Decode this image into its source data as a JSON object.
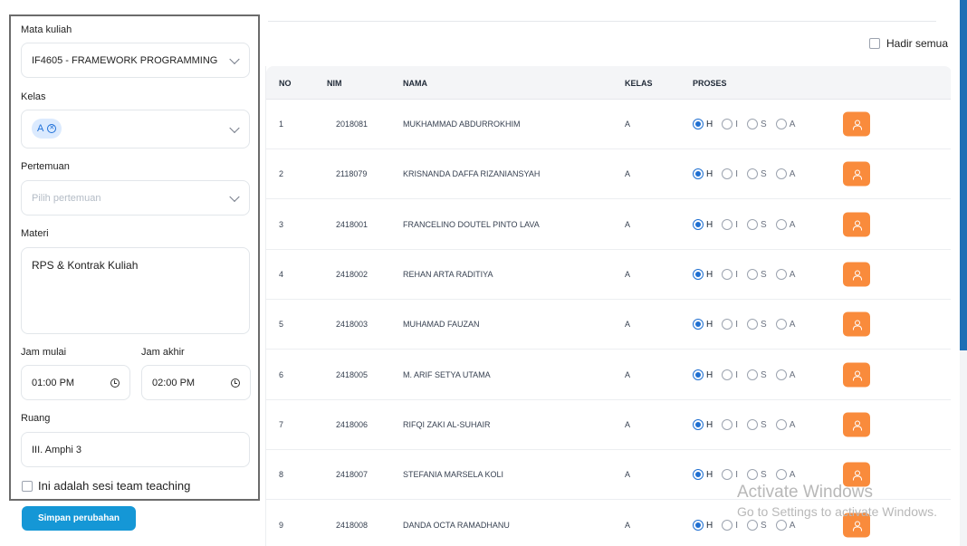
{
  "form": {
    "mata_kuliah_label": "Mata kuliah",
    "mata_kuliah_value": "IF4605 - FRAMEWORK PROGRAMMING",
    "kelas_label": "Kelas",
    "kelas_tag": "A",
    "pertemuan_label": "Pertemuan",
    "pertemuan_placeholder": "Pilih pertemuan",
    "materi_label": "Materi",
    "materi_value": "RPS & Kontrak Kuliah",
    "jam_mulai_label": "Jam mulai",
    "jam_mulai_value": "01:00 PM",
    "jam_akhir_label": "Jam akhir",
    "jam_akhir_value": "02:00 PM",
    "ruang_label": "Ruang",
    "ruang_value": "III. Amphi 3",
    "team_teaching_label": "Ini adalah sesi team teaching",
    "save_label": "Simpan perubahan"
  },
  "hadir_semua_label": "Hadir semua",
  "table": {
    "headers": {
      "no": "NO",
      "nim": "NIM",
      "nama": "NAMA",
      "kelas": "KELAS",
      "proses": "PROSES"
    },
    "radio_labels": [
      "H",
      "I",
      "S",
      "A"
    ],
    "rows": [
      {
        "no": "1",
        "nim": "2018081",
        "nama": "MUKHAMMAD ABDURROKHIM",
        "kelas": "A",
        "selected": "H"
      },
      {
        "no": "2",
        "nim": "2118079",
        "nama": "KRISNANDA DAFFA RIZANIANSYAH",
        "kelas": "A",
        "selected": "H"
      },
      {
        "no": "3",
        "nim": "2418001",
        "nama": "FRANCELINO DOUTEL PINTO LAVA",
        "kelas": "A",
        "selected": "H"
      },
      {
        "no": "4",
        "nim": "2418002",
        "nama": "REHAN ARTA RADITIYA",
        "kelas": "A",
        "selected": "H"
      },
      {
        "no": "5",
        "nim": "2418003",
        "nama": "MUHAMAD FAUZAN",
        "kelas": "A",
        "selected": "H"
      },
      {
        "no": "6",
        "nim": "2418005",
        "nama": "M. ARIF SETYA UTAMA",
        "kelas": "A",
        "selected": "H"
      },
      {
        "no": "7",
        "nim": "2418006",
        "nama": "RIFQI ZAKI AL-SUHAIR",
        "kelas": "A",
        "selected": "H"
      },
      {
        "no": "8",
        "nim": "2418007",
        "nama": "STEFANIA MARSELA KOLI",
        "kelas": "A",
        "selected": "H"
      },
      {
        "no": "9",
        "nim": "2418008",
        "nama": "DANDA OCTA RAMADHANU",
        "kelas": "A",
        "selected": "H"
      }
    ]
  },
  "watermark": {
    "line1": "Activate Windows",
    "line2": "Go to Settings to activate Windows."
  },
  "colors": {
    "accent": "#1597d6",
    "action_button": "#f98b3c",
    "radio_selected": "#1f6fd1"
  }
}
